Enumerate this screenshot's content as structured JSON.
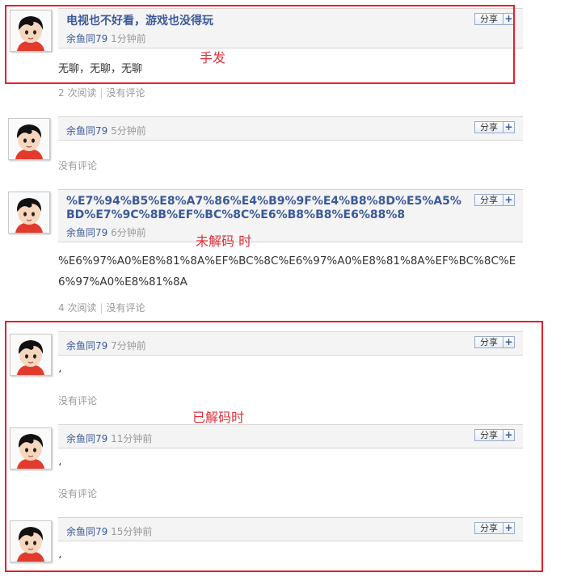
{
  "share_label": "分享",
  "share_plus": "+",
  "posts": [
    {
      "title": "电视也不好看，游戏也没得玩",
      "author": "余鱼同79",
      "time": "1分钟前",
      "body": "无聊，无聊，无聊",
      "reads": "2 次阅读",
      "comments": "没有评论"
    },
    {
      "author": "余鱼同79",
      "time": "5分钟前",
      "comments": "没有评论"
    },
    {
      "title": "%E7%94%B5%E8%A7%86%E4%B9%9F%E4%B8%8D%E5%A5%BD%E7%9C%8B%EF%BC%8C%E6%B8%B8%E6%88%8",
      "author": "余鱼同79",
      "time": "6分钟前",
      "body": "%E6%97%A0%E8%81%8A%EF%BC%8C%E6%97%A0%E8%81%8A%EF%BC%8C%E6%97%A0%E8%81%8A",
      "reads": "4 次阅读",
      "comments": "没有评论"
    },
    {
      "author": "余鱼同79",
      "time": "7分钟前",
      "body": "،",
      "comments": "没有评论"
    },
    {
      "author": "余鱼同79",
      "time": "11分钟前",
      "body": "،",
      "comments": "没有评论"
    },
    {
      "author": "余鱼同79",
      "time": "15分钟前",
      "body": "،"
    }
  ],
  "annotations": {
    "manual": "手发",
    "undecoded": "未解码 时",
    "decoded": "已解码时"
  },
  "colors": {
    "accent": "#3b5998",
    "annotation_red": "#e81d2a"
  }
}
